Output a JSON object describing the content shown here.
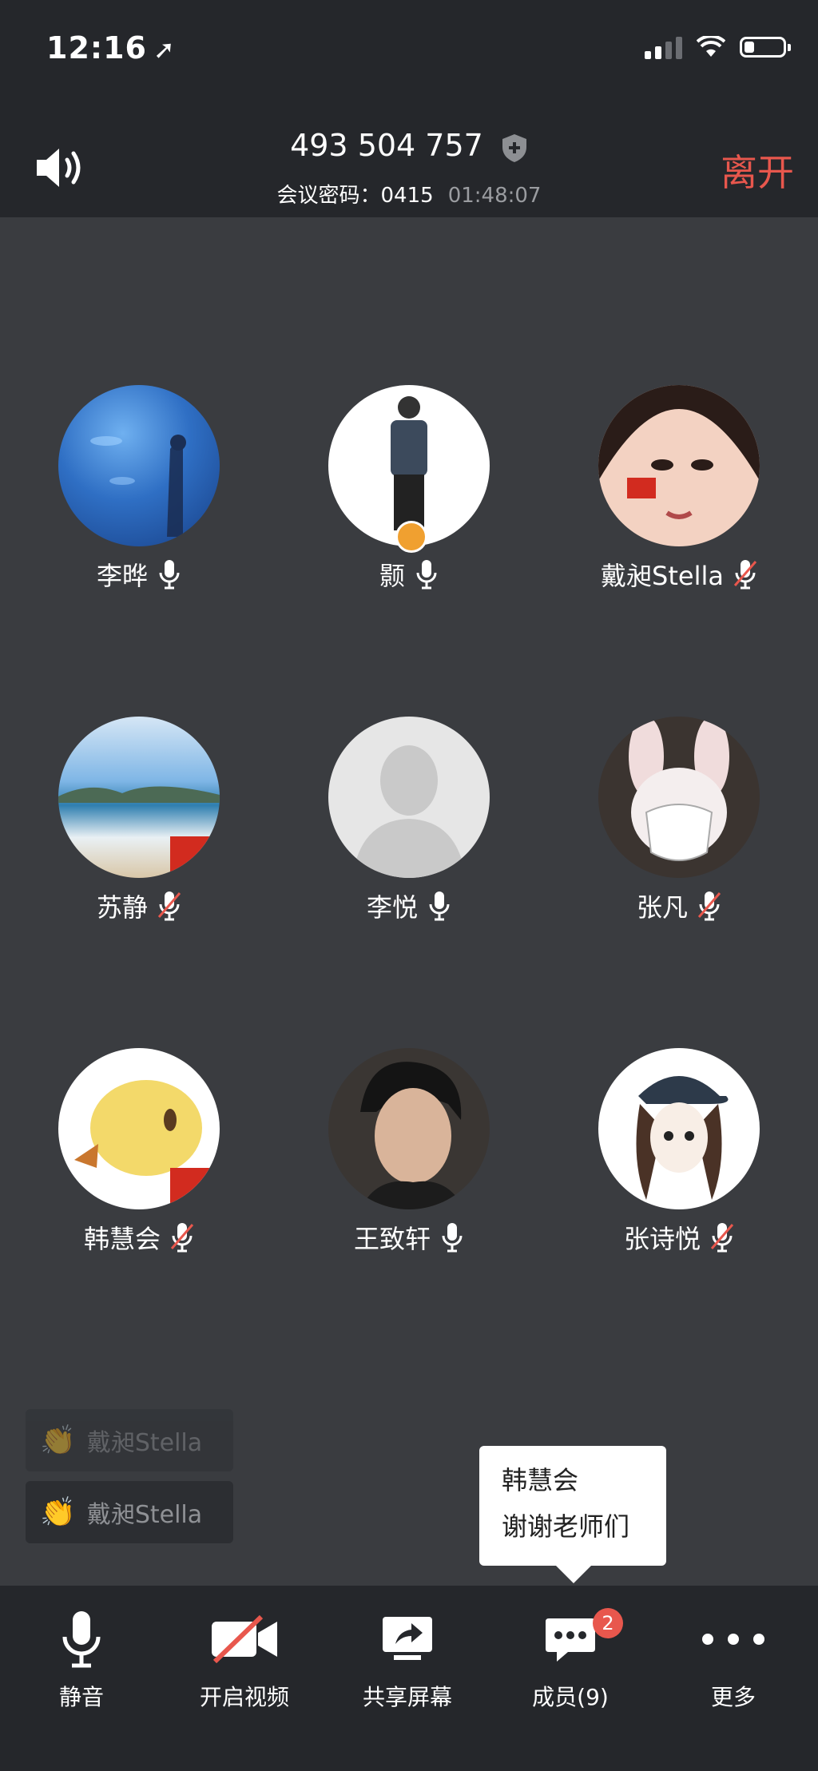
{
  "status_bar": {
    "time": "12:16"
  },
  "header": {
    "meeting_id": "493 504 757",
    "password_label": "会议密码：0415",
    "timer": "01:48:07",
    "leave": "离开"
  },
  "participants": [
    {
      "name": "李晔",
      "mic": "on",
      "avatar": "aquarium-photo"
    },
    {
      "name": "颢",
      "mic": "on",
      "avatar": "standing-person-photo",
      "host": true
    },
    {
      "name": "戴昶Stella",
      "mic": "muted",
      "avatar": "portrait-photo-with-flag"
    },
    {
      "name": "苏静",
      "mic": "muted",
      "avatar": "beach-photo-with-flag"
    },
    {
      "name": "李悦",
      "mic": "on",
      "avatar": "default-avatar"
    },
    {
      "name": "张凡",
      "mic": "muted",
      "avatar": "rabbit-mask-photo"
    },
    {
      "name": "韩慧会",
      "mic": "muted",
      "avatar": "yellow-chick-with-flag"
    },
    {
      "name": "王致轩",
      "mic": "on",
      "avatar": "young-man-photo"
    },
    {
      "name": "张诗悦",
      "mic": "muted",
      "avatar": "cartoon-girl"
    }
  ],
  "reactions": [
    {
      "name": "戴昶Stella",
      "icon": "clap-icon"
    },
    {
      "name": "戴昶Stella",
      "icon": "clap-icon"
    }
  ],
  "chat_bubble": {
    "sender": "韩慧会",
    "message": "谢谢老师们"
  },
  "toolbar": {
    "mute": "静音",
    "video": "开启视频",
    "share": "共享屏幕",
    "members": "成员(9)",
    "members_badge": "2",
    "more": "更多"
  },
  "colors": {
    "accent_red": "#e8574d",
    "bar_bg": "#25272b",
    "grid_bg": "#3a3c40"
  }
}
